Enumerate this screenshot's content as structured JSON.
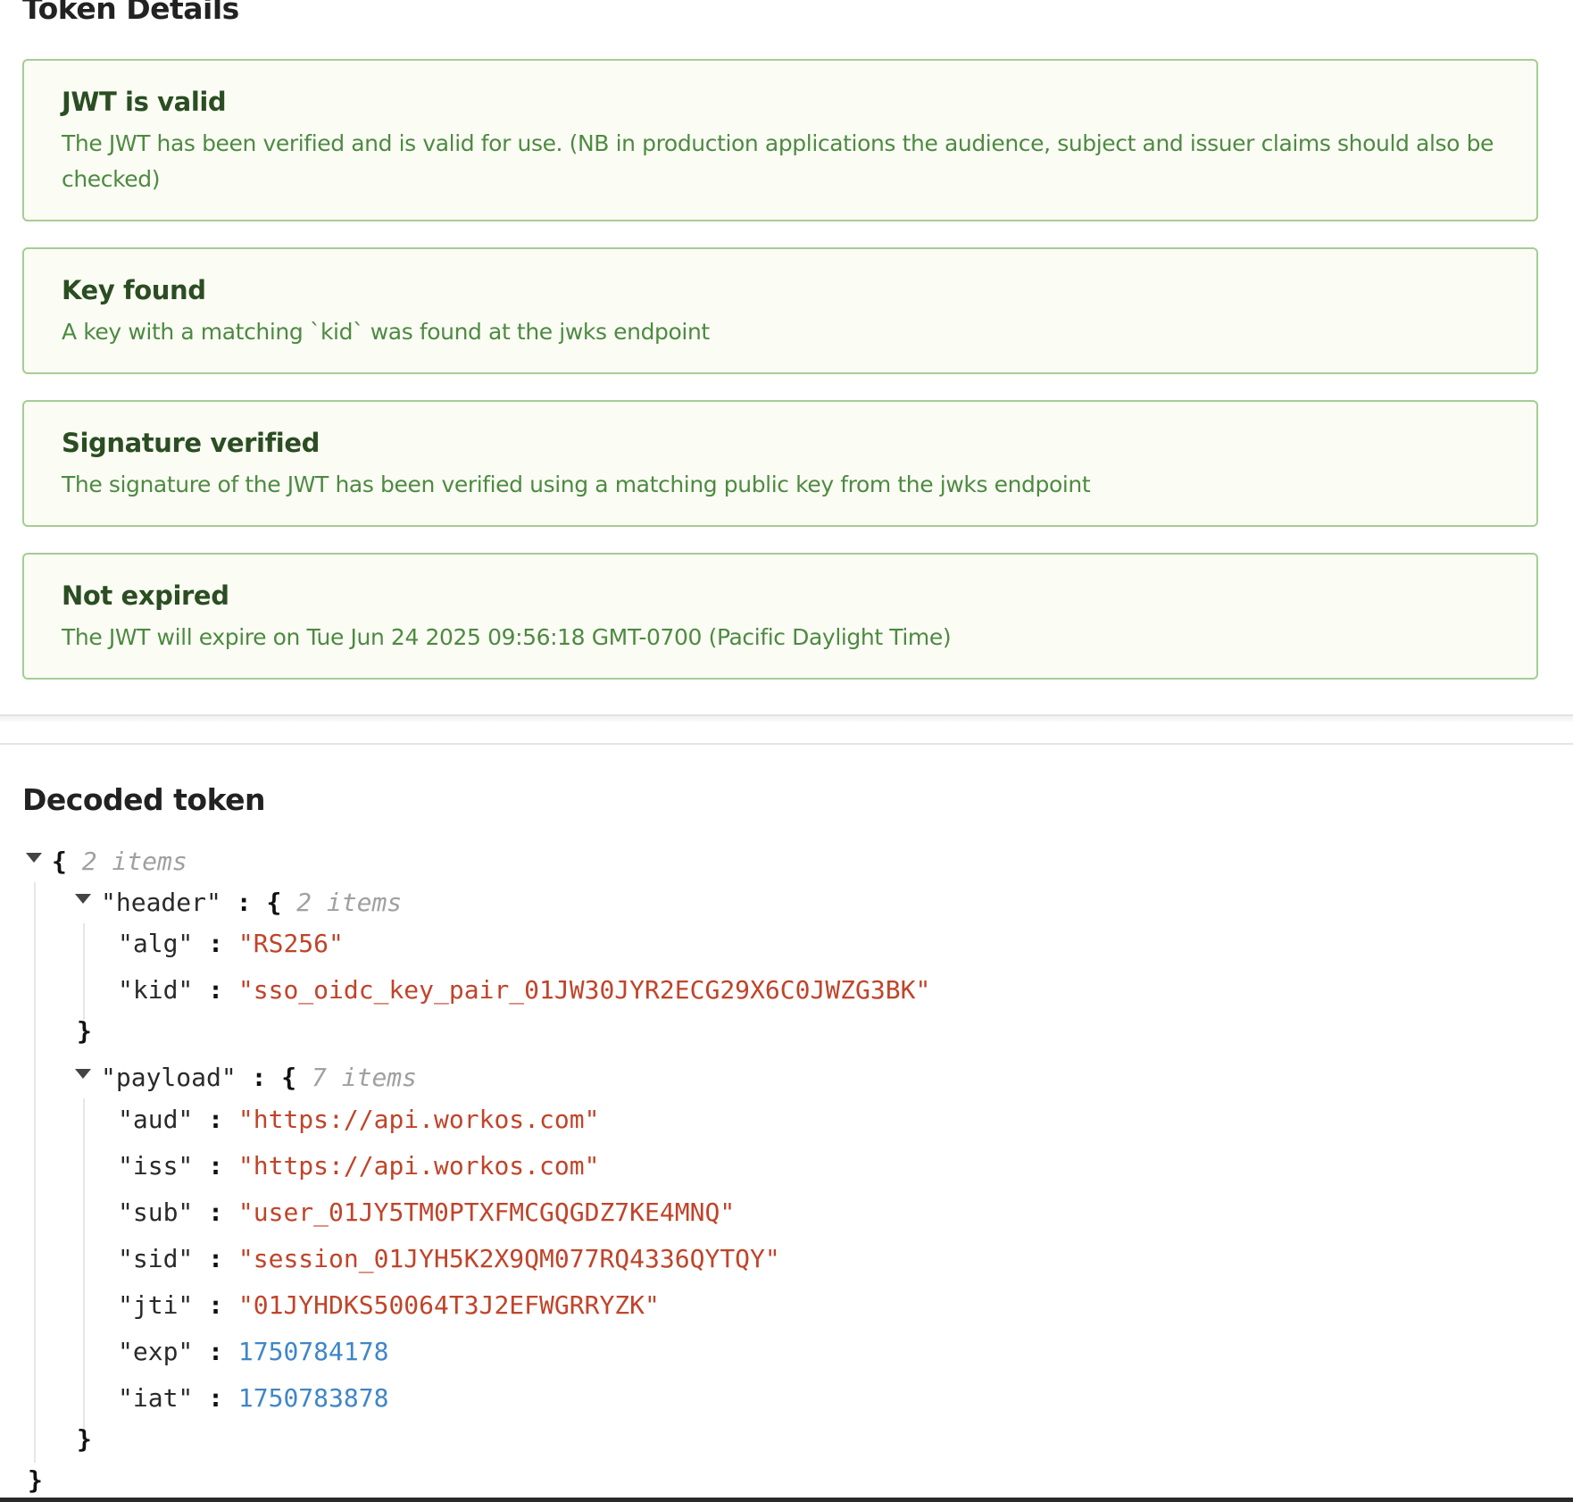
{
  "token_details": {
    "title": "Token Details",
    "cards": [
      {
        "title": "JWT is valid",
        "text": "The JWT has been verified and is valid for use. (NB in production applications the audience, subject and issuer claims should also be checked)"
      },
      {
        "title": "Key found",
        "text": "A key with a matching `kid` was found at the jwks endpoint"
      },
      {
        "title": "Signature verified",
        "text": "The signature of the JWT has been verified using a matching public key from the jwks endpoint"
      },
      {
        "title": "Not expired",
        "text": "The JWT will expire on Tue Jun 24 2025 09:56:18 GMT-0700 (Pacific Daylight Time)"
      }
    ]
  },
  "decoded": {
    "title": "Decoded token",
    "root_count": "2 items",
    "header": {
      "key": "\"header\"",
      "count": "2 items",
      "entries": [
        {
          "key": "\"alg\"",
          "value": "\"RS256\"",
          "type": "string"
        },
        {
          "key": "\"kid\"",
          "value": "\"sso_oidc_key_pair_01JW30JYR2ECG29X6C0JWZG3BK\"",
          "type": "string"
        }
      ]
    },
    "payload": {
      "key": "\"payload\"",
      "count": "7 items",
      "entries": [
        {
          "key": "\"aud\"",
          "value": "\"https://api.workos.com\"",
          "type": "string"
        },
        {
          "key": "\"iss\"",
          "value": "\"https://api.workos.com\"",
          "type": "string"
        },
        {
          "key": "\"sub\"",
          "value": "\"user_01JY5TM0PTXFMCGQGDZ7KE4MNQ\"",
          "type": "string"
        },
        {
          "key": "\"sid\"",
          "value": "\"session_01JYH5K2X9QM077RQ4336QYTQY\"",
          "type": "string"
        },
        {
          "key": "\"jti\"",
          "value": "\"01JYHDKS50064T3J2EFWGRRYZK\"",
          "type": "string"
        },
        {
          "key": "\"exp\"",
          "value": "1750784178",
          "type": "number"
        },
        {
          "key": "\"iat\"",
          "value": "1750783878",
          "type": "number"
        }
      ]
    },
    "colors": {
      "string": "#c0442a",
      "number": "#3f86c8",
      "count": "#a0a0a0",
      "card_border": "#a6cc94",
      "card_title": "#2b4d22",
      "card_text": "#4d8a40"
    }
  }
}
